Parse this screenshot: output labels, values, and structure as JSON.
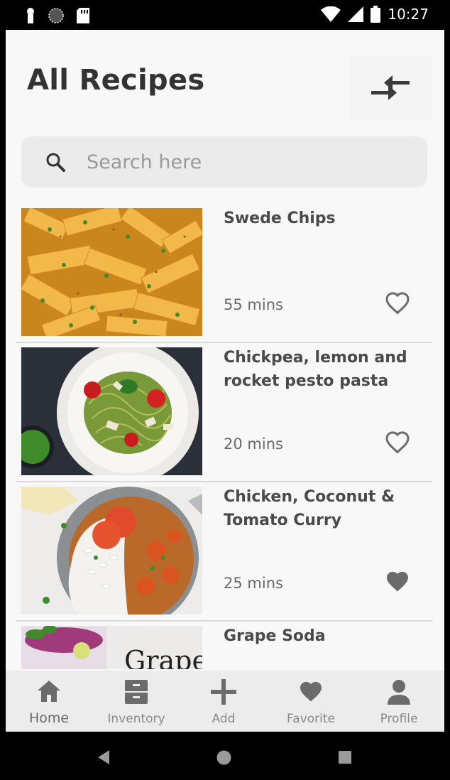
{
  "status_bar": {
    "time": "10:27"
  },
  "header": {
    "title": "All Recipes"
  },
  "search": {
    "placeholder": "Search here"
  },
  "recipes": [
    {
      "name": "Swede Chips",
      "time": "55 mins",
      "favorite": false
    },
    {
      "name": "Chickpea, lemon and rocket pesto pasta",
      "time": "20 mins",
      "favorite": false
    },
    {
      "name": "Chicken, Coconut & Tomato Curry",
      "time": "25 mins",
      "favorite": true
    },
    {
      "name": "Grape Soda",
      "time": "",
      "favorite": false
    }
  ],
  "thumb_text": {
    "grape": "Grape"
  },
  "bottom_nav": [
    {
      "label": "Home",
      "icon": "home-icon",
      "active": true
    },
    {
      "label": "Inventory",
      "icon": "inventory-icon",
      "active": false
    },
    {
      "label": "Add",
      "icon": "plus-icon",
      "active": false
    },
    {
      "label": "Favorite",
      "icon": "heart-icon",
      "active": false
    },
    {
      "label": "Profile",
      "icon": "person-icon",
      "active": false
    }
  ],
  "colors": {
    "background": "#f8f8f8",
    "text": "#333333",
    "icon": "#6b6b6b",
    "divider": "#dcdcdc"
  }
}
